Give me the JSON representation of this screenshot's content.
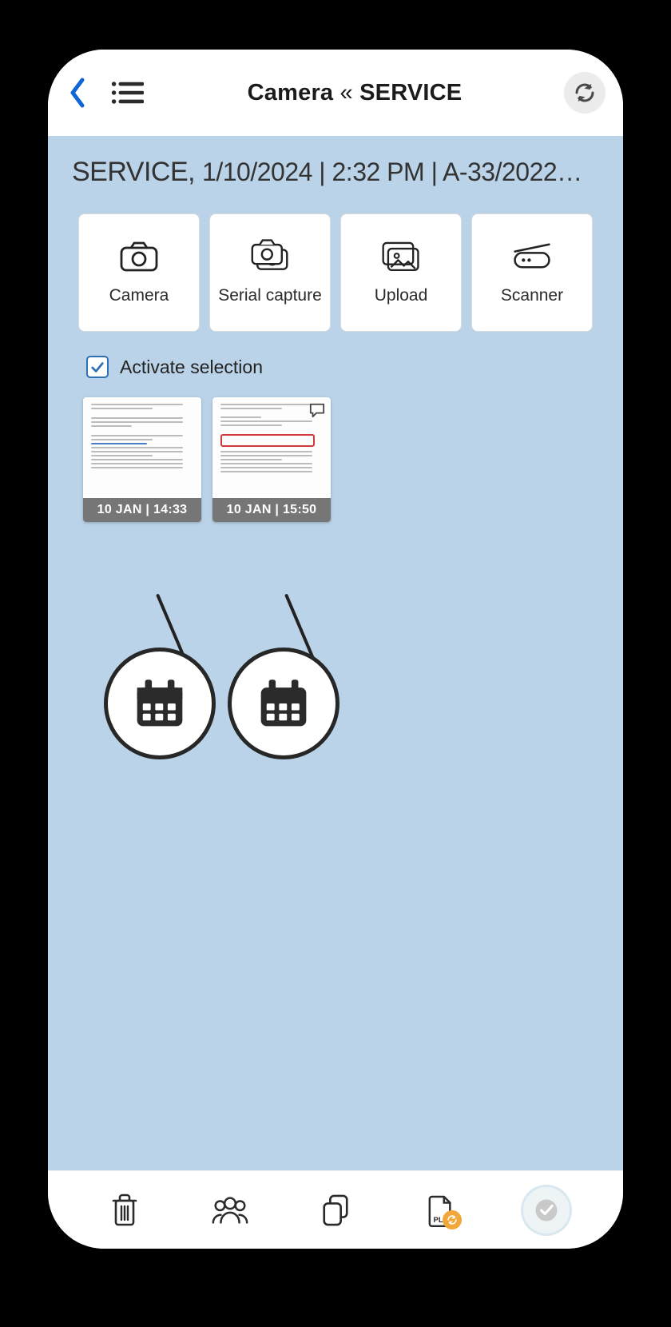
{
  "header": {
    "title_prefix": "Camera",
    "title_sep": "«",
    "title_suffix": "SERVICE"
  },
  "context": {
    "strong": "SERVICE, ",
    "rest": "1/10/2024 | 2:32 PM | A-33/2022…"
  },
  "tiles": [
    {
      "id": "camera",
      "label": "Camera",
      "icon": "camera-icon"
    },
    {
      "id": "serial",
      "label": "Serial capture",
      "icon": "serial-capture-icon"
    },
    {
      "id": "upload",
      "label": "Upload",
      "icon": "upload-icon"
    },
    {
      "id": "scanner",
      "label": "Scanner",
      "icon": "scanner-icon"
    }
  ],
  "activate": {
    "label": "Activate selection",
    "checked": true
  },
  "thumbnails": [
    {
      "caption": "10 JAN | 14:33",
      "has_comment": false,
      "has_highlight": false
    },
    {
      "caption": "10 JAN | 15:50",
      "has_comment": true,
      "has_highlight": true
    }
  ],
  "callouts": [
    {
      "icon": "calendar-icon"
    },
    {
      "icon": "calendar-icon"
    }
  ],
  "bottom": {
    "items": [
      "trash",
      "group",
      "copy",
      "placeholder",
      "confirm"
    ]
  }
}
